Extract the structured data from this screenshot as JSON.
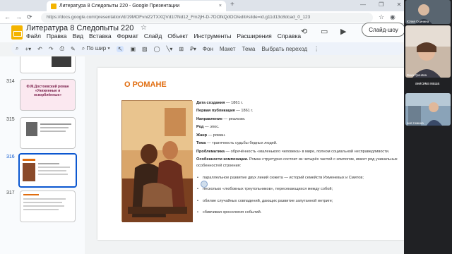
{
  "browser": {
    "tab_title": "Литература 8 Следопыты 220 - Google Презентации",
    "tab_close": "×",
    "new_tab": "+",
    "window_controls": "— ❐ ✕",
    "url": "https://docs.google.com/presentation/d/19MOFvniZzTXXQVd1l7Nd12_Fm2jH-D-7DOfkQdOO/edit#slide=id.g11d13c8dcad_0_123"
  },
  "app": {
    "doc_title": "Литература 8 Следопыты 220",
    "menu": [
      "Файл",
      "Правка",
      "Вид",
      "Вставка",
      "Формат",
      "Слайд",
      "Объект",
      "Инструменты",
      "Расширения",
      "Справка"
    ],
    "slideshow_label": "Слайд-шоу"
  },
  "toolbar": {
    "zoom_label": "По шир",
    "background_label": "Фон",
    "layout_label": "Макет",
    "theme_label": "Тема",
    "transition_label": "Выбрать переход"
  },
  "filmstrip": {
    "slides": [
      {
        "number": "314",
        "title": "Ф.М.Достоевский роман «Униженные и оскорблённые»"
      },
      {
        "number": "315",
        "title": ""
      },
      {
        "number": "316",
        "title": ""
      },
      {
        "number": "317",
        "title": ""
      }
    ],
    "active_number": "316"
  },
  "slide": {
    "title": "О РОМАНЕ",
    "facts": [
      {
        "label": "Дата создания",
        "value": " — 1861 г."
      },
      {
        "label": "Первая публикация",
        "value": " — 1861 г."
      },
      {
        "label": "Направление",
        "value": " — реализм."
      },
      {
        "label": "Род",
        "value": " — эпос."
      },
      {
        "label": "Жанр",
        "value": " — роман."
      },
      {
        "label": "Тема",
        "value": " — трагичность судьбы бедных людей."
      },
      {
        "label": "Проблематика",
        "value": " — обречённость «маленького человека» в мире, полном социальной несправедливости."
      }
    ],
    "composition_label": "Особенности композиции.",
    "composition_text": " Роман структурно состоит из четырёх частей с эпилогом, имеет ряд уникальных особенностей строения:",
    "bullets": [
      "параллельное развитие двух линий сюжета — историй семейств Ихменевых и Смитов;",
      "несколько «любовных треугольников», пересекающихся между собой;",
      "обилие случайных совпадений, дающих развитие запутанной интриге;",
      "сбивчивая хронология событий."
    ]
  },
  "video_call": {
    "participants": [
      {
        "name": "Юлия Осинина"
      },
      {
        "name": "Вика Грачёва"
      },
      {
        "name": "анисима маша"
      },
      {
        "name": "аня томина"
      }
    ]
  }
}
